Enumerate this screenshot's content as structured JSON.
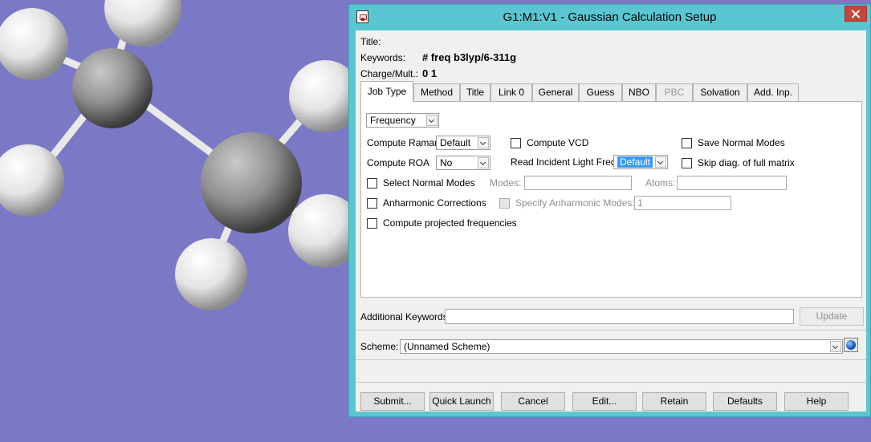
{
  "window": {
    "title": "G1:M1:V1 - Gaussian Calculation Setup"
  },
  "header": {
    "title_label": "Title:",
    "keywords_label": "Keywords:",
    "keywords_value": "# freq b3lyp/6-311g",
    "charge_label": "Charge/Mult.:",
    "charge_value": "0 1"
  },
  "tabs": [
    {
      "label": "Job Type",
      "active": true
    },
    {
      "label": "Method"
    },
    {
      "label": "Title"
    },
    {
      "label": "Link 0"
    },
    {
      "label": "General"
    },
    {
      "label": "Guess"
    },
    {
      "label": "NBO"
    },
    {
      "label": "PBC",
      "disabled": true
    },
    {
      "label": "Solvation"
    },
    {
      "label": "Add. Inp."
    }
  ],
  "job_type": {
    "job_select": "Frequency",
    "compute_raman_label": "Compute Raman",
    "compute_raman_value": "Default",
    "compute_roa_label": "Compute ROA",
    "compute_roa_value": "No",
    "compute_vcd_label": "Compute VCD",
    "read_incident_label": "Read Incident Light Freqs",
    "read_incident_value": "Default",
    "save_normal_modes_label": "Save Normal Modes",
    "skip_diag_label": "Skip diag. of full matrix",
    "select_normal_modes_label": "Select Normal Modes",
    "modes_label": "Modes:",
    "atoms_label": "Atoms:",
    "anharmonic_label": "Anharmonic Corrections",
    "specify_anharmonic_label": "Specify Anharmonic Modes:",
    "specify_anharmonic_value": "1",
    "projected_freq_label": "Compute projected frequencies"
  },
  "additional": {
    "label": "Additional Keywords:",
    "value": "",
    "update_label": "Update"
  },
  "scheme": {
    "label": "Scheme:",
    "value": "(Unnamed Scheme)"
  },
  "buttons": {
    "submit": "Submit...",
    "quick_launch": "Quick Launch",
    "cancel": "Cancel",
    "edit": "Edit...",
    "retain": "Retain",
    "defaults": "Defaults",
    "help": "Help"
  },
  "colors": {
    "background": "#7b78c6",
    "titlebar": "#5bc6d2",
    "selection": "#3399ff"
  }
}
